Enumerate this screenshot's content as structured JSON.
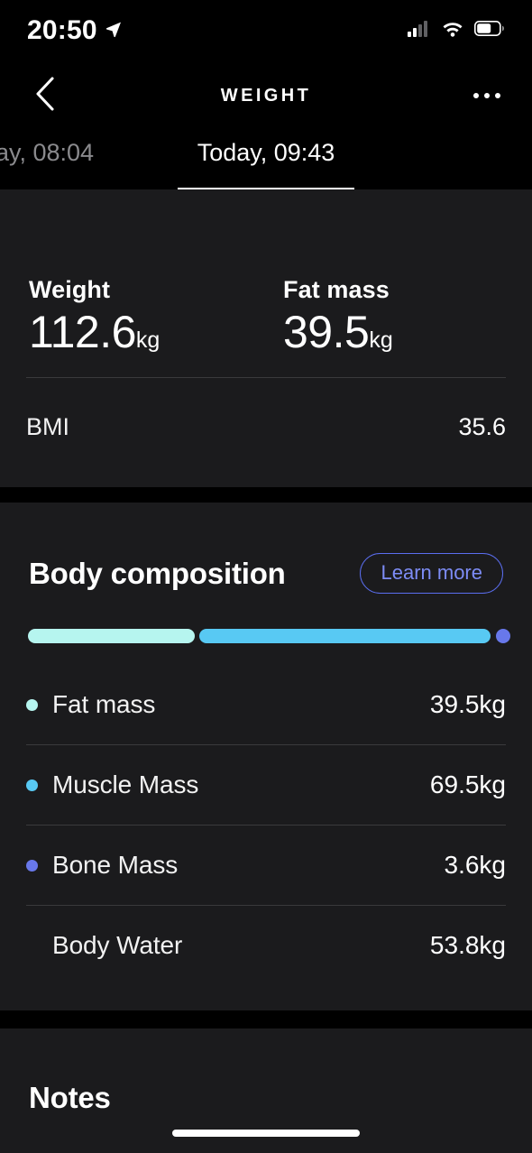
{
  "statusbar": {
    "time": "20:50",
    "location_icon": "location-arrow-icon",
    "cellular_icon": "cellular-signal-icon",
    "wifi_icon": "wifi-icon",
    "battery_icon": "battery-icon",
    "battery_level_pct": 60
  },
  "navbar": {
    "back_icon": "chevron-left-icon",
    "title": "WEIGHT",
    "more_icon": "more-horizontal-icon"
  },
  "tabs": {
    "items": [
      {
        "label": "ay, 08:04",
        "active": false
      },
      {
        "label": "Today, 09:43",
        "active": true
      }
    ]
  },
  "weight_card": {
    "metrics": [
      {
        "label": "Weight",
        "value": "112.6",
        "unit": "kg"
      },
      {
        "label": "Fat mass",
        "value": "39.5",
        "unit": "kg"
      }
    ],
    "bmi": {
      "key": "BMI",
      "value": "35.6"
    }
  },
  "composition_card": {
    "title": "Body composition",
    "learn_more_label": "Learn more",
    "rows": [
      {
        "label": "Fat mass",
        "value": "39.5kg",
        "color": "#b6f5ef"
      },
      {
        "label": "Muscle Mass",
        "value": "69.5kg",
        "color": "#58c9f3"
      },
      {
        "label": "Bone Mass",
        "value": "3.6kg",
        "color": "#6878ea"
      },
      {
        "label": "Body Water",
        "value": "53.8kg",
        "color": ""
      }
    ]
  },
  "notes_card": {
    "title": "Notes"
  },
  "colors": {
    "background": "#000000",
    "card": "#1b1b1d",
    "divider": "#3a3a3c",
    "accent_blue": "#5b6ef0",
    "fat_mass": "#b6f5ef",
    "muscle_mass": "#58c9f3",
    "bone_mass": "#6878ea",
    "text_primary": "#ffffff",
    "text_muted": "#8a8a8d"
  },
  "chart_data": {
    "type": "bar",
    "title": "Body composition",
    "categories": [
      "Fat mass",
      "Muscle Mass",
      "Bone Mass"
    ],
    "values": [
      39.5,
      69.5,
      3.6
    ],
    "unit": "kg",
    "colors": [
      "#b6f5ef",
      "#58c9f3",
      "#6878ea"
    ],
    "orientation": "horizontal-stacked",
    "total": 112.6,
    "xlabel": "",
    "ylabel": "",
    "grid": false,
    "legend": "below"
  }
}
